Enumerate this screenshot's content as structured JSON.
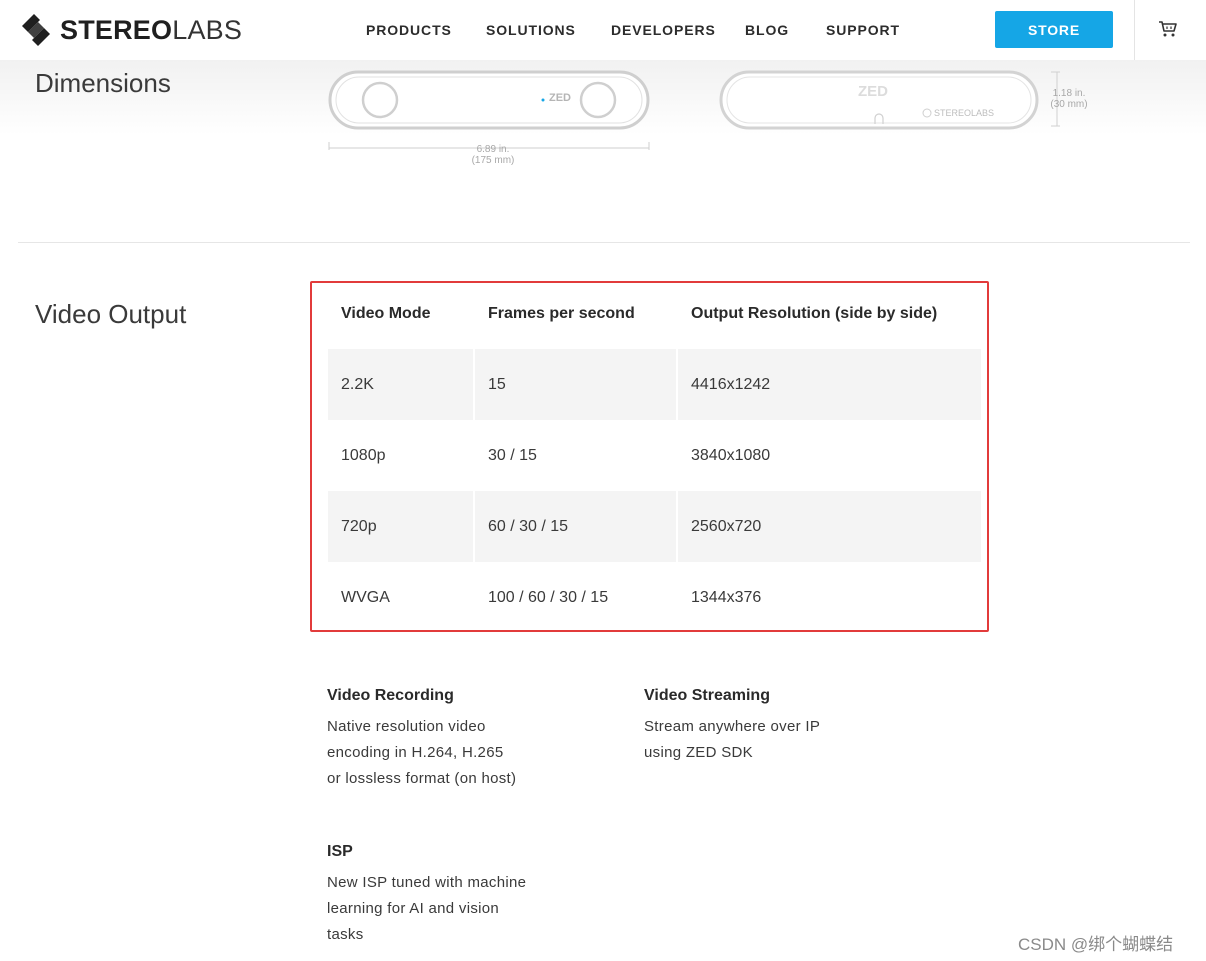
{
  "header": {
    "logo": {
      "bold": "STEREO",
      "light": "LABS"
    },
    "nav": [
      "PRODUCTS",
      "SOLUTIONS",
      "DEVELOPERS",
      "BLOG",
      "SUPPORT"
    ],
    "store_label": "STORE",
    "cart_icon": "cart-icon"
  },
  "dimensions": {
    "title": "Dimensions",
    "front_brand": "ZED",
    "back_brand": "ZED",
    "back_maker": "STEREOLABS",
    "width_in": "6.89 in.",
    "width_mm": "(175 mm)",
    "height_in": "1.18 in.",
    "height_mm": "(30 mm)"
  },
  "video_output": {
    "title": "Video Output",
    "headers": [
      "Video Mode",
      "Frames per second",
      "Output Resolution (side by side)"
    ],
    "rows": [
      [
        "2.2K",
        "15",
        "4416x1242"
      ],
      [
        "1080p",
        "30 / 15",
        "3840x1080"
      ],
      [
        "720p",
        "60 / 30 / 15",
        "2560x720"
      ],
      [
        "WVGA",
        "100 / 60 / 30 / 15",
        "1344x376"
      ]
    ],
    "highlight_color": "#e23b3b"
  },
  "features": [
    {
      "title": "Video Recording",
      "lines": [
        "Native resolution video",
        "encoding in H.264, H.265",
        "or lossless format (on host)"
      ]
    },
    {
      "title": "Video Streaming",
      "lines": [
        "Stream anywhere over IP",
        "using ZED SDK"
      ]
    },
    {
      "title": "ISP",
      "lines": [
        "New ISP tuned with machine",
        "learning for AI and vision",
        "tasks"
      ]
    }
  ],
  "watermark": "CSDN @绑个蝴蝶结",
  "colors": {
    "accent": "#15a6e6",
    "text": "#3a3a3a",
    "highlight": "#e23b3b"
  }
}
